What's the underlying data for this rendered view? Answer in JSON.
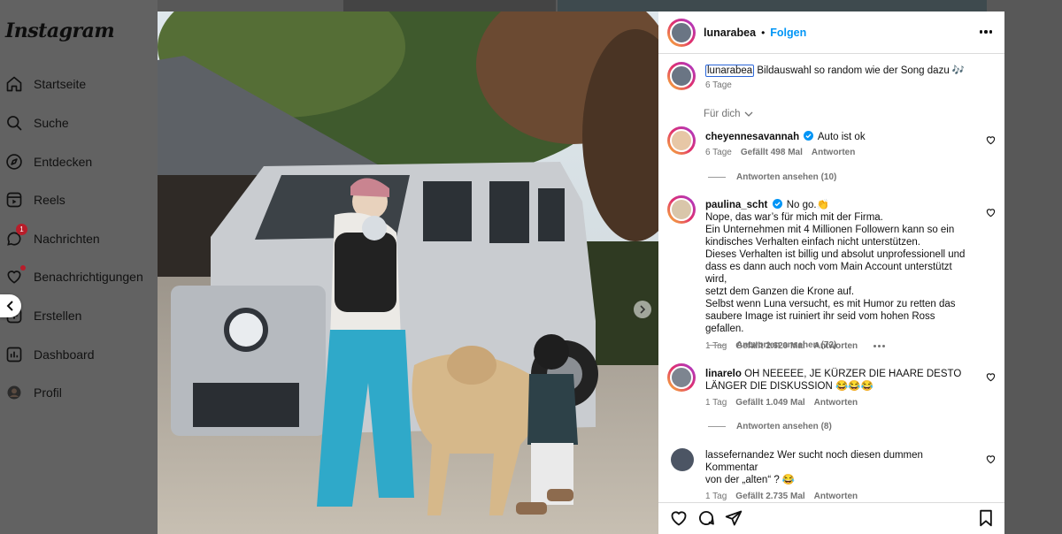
{
  "app": {
    "logo": "Instagram"
  },
  "nav": [
    {
      "label": "Startseite",
      "icon": "home-icon"
    },
    {
      "label": "Suche",
      "icon": "search-icon"
    },
    {
      "label": "Entdecken",
      "icon": "compass-icon"
    },
    {
      "label": "Reels",
      "icon": "reels-icon"
    },
    {
      "label": "Nachrichten",
      "icon": "messenger-icon",
      "badge": "1"
    },
    {
      "label": "Benachrichtigungen",
      "icon": "heart-icon"
    },
    {
      "label": "Erstellen",
      "icon": "plus-icon"
    },
    {
      "label": "Dashboard",
      "icon": "dashboard-icon"
    },
    {
      "label": "Profil",
      "icon": "avatar-icon"
    }
  ],
  "post": {
    "author": "lunarabea",
    "separator": "•",
    "follow_label": "Folgen",
    "caption_user": "lunarabea",
    "caption_text": "Bildauswahl so random wie der Song dazu 🎶",
    "caption_time": "6 Tage",
    "sort_label": "Für dich"
  },
  "comments": [
    {
      "user": "cheyennesavannah",
      "verified": true,
      "text": "Auto ist ok",
      "time": "6 Tage",
      "likes": "Gefällt 498 Mal",
      "reply": "Antworten",
      "view_replies": "Antworten ansehen (10)"
    },
    {
      "user": "paulina_scht",
      "verified": true,
      "text_lines": [
        "No go.👏",
        "Nope, das war’s für mich mit der Firma.",
        "Ein Unternehmen mit 4 Millionen Followern kann so ein",
        "kindisches Verhalten einfach nicht unterstützen.",
        "Dieses Verhalten ist billig und absolut unprofessionell und",
        "dass es dann auch noch vom Main Account unterstützt wird,",
        "setzt dem Ganzen die Krone auf.",
        "Selbst wenn Luna versucht, es mit Humor zu retten das",
        "saubere Image ist ruiniert ihr seid vom hohen Ross gefallen."
      ],
      "time": "1 Tag",
      "likes": "Gefällt 2.620 Mal",
      "reply": "Antworten",
      "view_replies": "Antworten ansehen (72)"
    },
    {
      "user": "linarelo",
      "verified": false,
      "text_lines": [
        "OH NEEEEE, JE KÜRZER DIE HAARE DESTO",
        "LÄNGER DIE DISKUSSION 😂😂😂"
      ],
      "time": "1 Tag",
      "likes": "Gefällt 1.049 Mal",
      "reply": "Antworten",
      "view_replies": "Antworten ansehen (8)"
    },
    {
      "user": "lassefernandez",
      "verified": false,
      "text_lines": [
        "Wer sucht noch diesen dummen Kommentar",
        "von der „alten“ ? 😂"
      ],
      "time": "1 Tag",
      "likes": "Gefällt 2.735 Mal",
      "reply": "Antworten"
    }
  ],
  "colors": {
    "accent": "#0095f6",
    "badge": "#b81d2a",
    "muted": "#737373"
  }
}
